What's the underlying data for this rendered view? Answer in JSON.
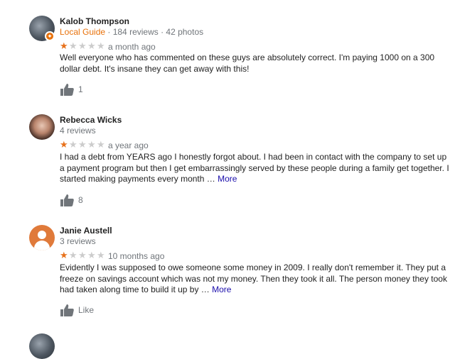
{
  "reviews": [
    {
      "name": "Kalob Thompson",
      "guide_label": "Local Guide",
      "meta": " · 184 reviews · 42 photos",
      "rating": 1,
      "age": "a month ago",
      "text": "Well everyone who  has commented on these guys are absolutely correct. I'm paying 1000 on a 300 dollar debt. It's insane they can get away with this!",
      "more": "",
      "likes": "1"
    },
    {
      "name": "Rebecca Wicks",
      "meta": "4 reviews",
      "rating": 1,
      "age": "a year ago",
      "text": "I had a debt from YEARS ago I honestly forgot about. I had been in contact with the company to set up a payment program but then I get embarrassingly served by these people during a family get together. I started making payments every month … ",
      "more": "More",
      "likes": "8"
    },
    {
      "name": "Janie Austell",
      "meta": "3 reviews",
      "rating": 1,
      "age": "10 months ago",
      "text": "Evidently I was supposed to owe someone some money in 2009. I really don't remember it. They put a freeze on savings account which was not my money. Then they took it  all. The person money they took had taken along time to build it up by … ",
      "more": "More",
      "likes": "Like"
    }
  ],
  "colors": {
    "star_on": "#e7711b",
    "star_off": "#cccccc",
    "link": "#1a0dab",
    "guide": "#e8710a"
  }
}
